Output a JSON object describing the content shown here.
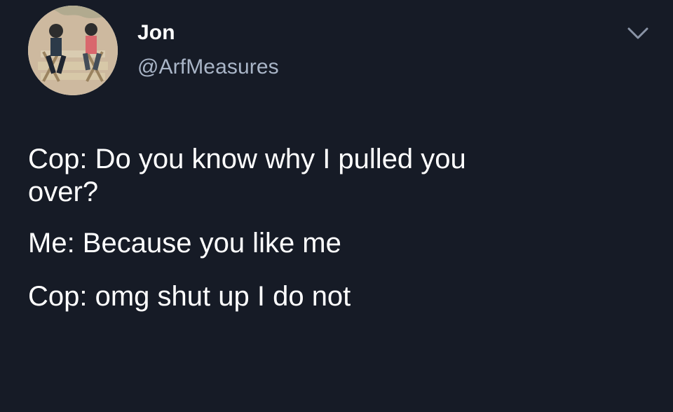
{
  "user": {
    "display_name": "Jon",
    "handle": "@ArfMeasures",
    "avatar_icon": "avatar-photo"
  },
  "menu": {
    "icon": "chevron-down-icon"
  },
  "tweet": {
    "line1": "Cop: Do you know why I pulled you",
    "line2": "over?",
    "line3": "Me: Because you like me",
    "line4": "Cop: omg shut up I do not"
  },
  "colors": {
    "background": "#161b26",
    "text": "#ffffff",
    "muted": "#a9b5c7"
  }
}
